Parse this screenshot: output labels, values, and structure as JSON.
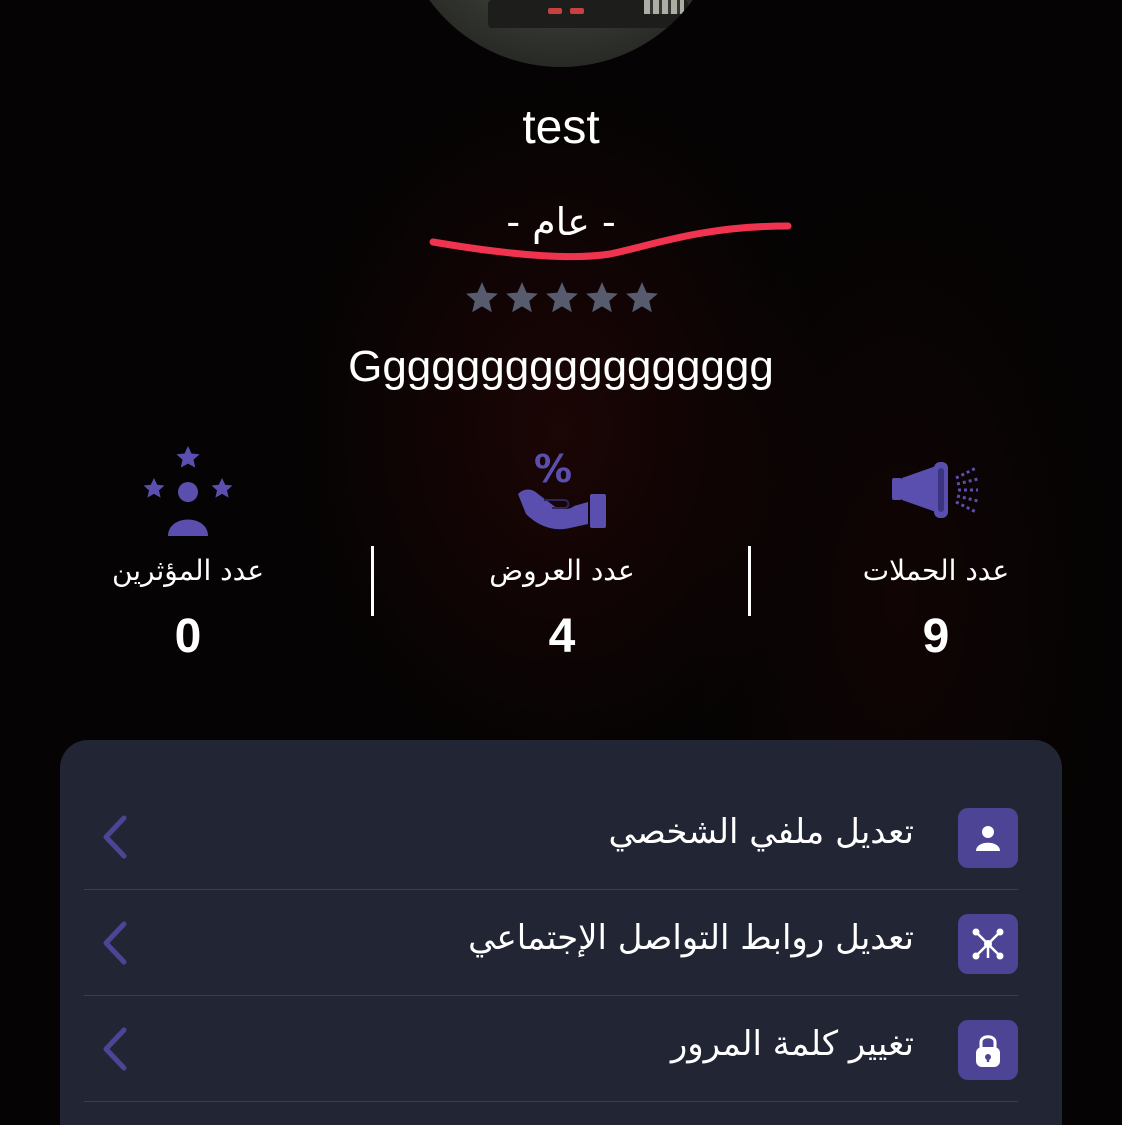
{
  "profile": {
    "name": "test",
    "category": "-  عام  -",
    "rating": 5,
    "bio": "Ggggggggggggggggg"
  },
  "stats": [
    {
      "label": "عدد الحملات",
      "value": "9",
      "icon": "megaphone-icon"
    },
    {
      "label": "عدد العروض",
      "value": "4",
      "icon": "discount-hand-icon"
    },
    {
      "label": "عدد المؤثرين",
      "value": "0",
      "icon": "influencer-stars-icon"
    }
  ],
  "menu": {
    "items": [
      {
        "label": "تعديل ملفي الشخصي",
        "icon": "user-icon"
      },
      {
        "label": "تعديل روابط التواصل الإجتماعي",
        "icon": "network-icon"
      },
      {
        "label": "تغيير كلمة المرور",
        "icon": "lock-icon"
      }
    ]
  },
  "colors": {
    "accent": "#4e4496",
    "icon": "#5a4fae",
    "panel": "#222634",
    "star": "#565b6e",
    "annotation": "#f0344f"
  }
}
